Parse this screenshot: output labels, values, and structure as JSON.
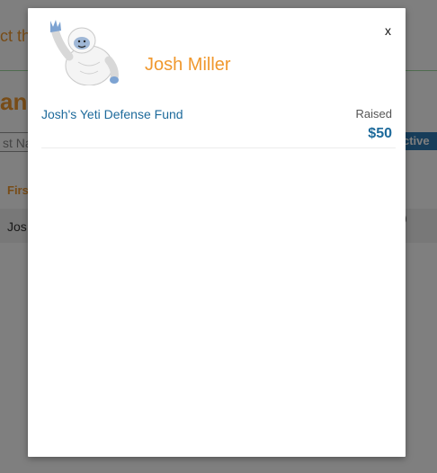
{
  "background": {
    "heading_fragment": "ct th",
    "title_fragment": "ana",
    "search_placeholder_fragment": "st Na",
    "tag_fragment": "ctive",
    "column_header_fragment": "Firs",
    "row_first_fragment": "Jos",
    "row_last_fragment": ")"
  },
  "modal": {
    "close_label": "x",
    "avatar_icon": "yeti-avatar",
    "user_name": "Josh Miller",
    "fund": {
      "name": "Josh's Yeti Defense Fund",
      "raised_label": "Raised",
      "raised_value": "$50"
    }
  },
  "colors": {
    "accent_orange": "#f0982e",
    "link_blue": "#1d6a9b",
    "tag_blue": "#2f7bb4",
    "overlay": "rgba(0,0,0,0.5)"
  }
}
